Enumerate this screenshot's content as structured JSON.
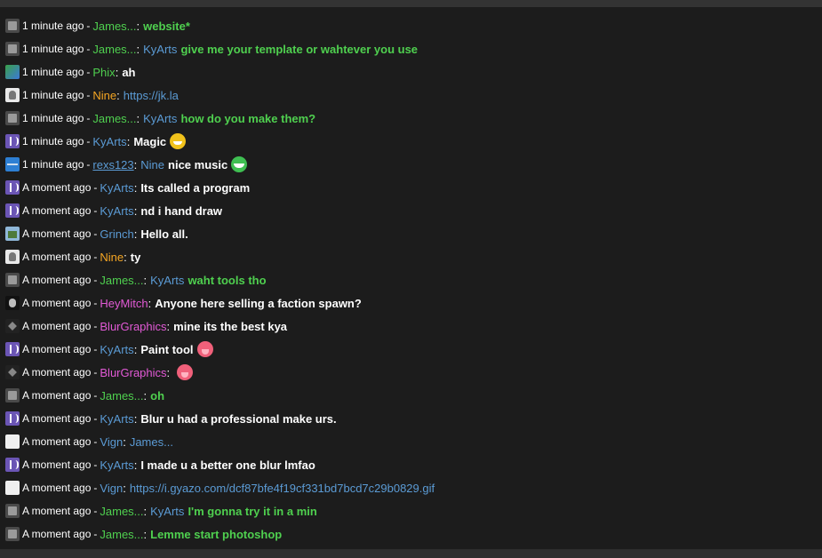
{
  "messages": [
    {
      "avatar": "james",
      "time": "1 minute ago",
      "user": "James...",
      "user_color": "green",
      "mention": "",
      "text": "website*",
      "text_color": "green",
      "link": "",
      "emoji": ""
    },
    {
      "avatar": "james",
      "time": "1 minute ago",
      "user": "James...",
      "user_color": "green",
      "mention": "KyArts",
      "text": "give me your template or wahtever you use",
      "text_color": "green",
      "link": "",
      "emoji": ""
    },
    {
      "avatar": "phix",
      "time": "1 minute ago",
      "user": "Phix",
      "user_color": "green",
      "mention": "",
      "text": "ah",
      "text_color": "white",
      "link": "",
      "emoji": ""
    },
    {
      "avatar": "nine",
      "time": "1 minute ago",
      "user": "Nine",
      "user_color": "orange",
      "mention": "",
      "text": "",
      "text_color": "white",
      "link": "https://jk.la",
      "emoji": ""
    },
    {
      "avatar": "james",
      "time": "1 minute ago",
      "user": "James...",
      "user_color": "green",
      "mention": "KyArts",
      "text": "how do you make them?",
      "text_color": "green",
      "link": "",
      "emoji": ""
    },
    {
      "avatar": "kyarts",
      "time": "1 minute ago",
      "user": "KyArts",
      "user_color": "blue",
      "mention": "",
      "text": "Magic",
      "text_color": "white",
      "link": "",
      "emoji": "grin"
    },
    {
      "avatar": "rexs",
      "time": "1 minute ago",
      "user": "rexs123",
      "user_color": "blue",
      "mention": "Nine",
      "text": "nice music",
      "text_color": "white",
      "link": "",
      "emoji": "green"
    },
    {
      "avatar": "kyarts",
      "time": "A moment ago",
      "user": "KyArts",
      "user_color": "blue",
      "mention": "",
      "text": "Its called a program",
      "text_color": "white",
      "link": "",
      "emoji": ""
    },
    {
      "avatar": "kyarts",
      "time": "A moment ago",
      "user": "KyArts",
      "user_color": "blue",
      "mention": "",
      "text": "nd i hand draw",
      "text_color": "white",
      "link": "",
      "emoji": ""
    },
    {
      "avatar": "grinch",
      "time": "A moment ago",
      "user": "Grinch",
      "user_color": "blue",
      "mention": "",
      "text": "Hello all.",
      "text_color": "white",
      "link": "",
      "emoji": ""
    },
    {
      "avatar": "nine",
      "time": "A moment ago",
      "user": "Nine",
      "user_color": "orange",
      "mention": "",
      "text": "ty",
      "text_color": "white",
      "link": "",
      "emoji": ""
    },
    {
      "avatar": "james",
      "time": "A moment ago",
      "user": "James...",
      "user_color": "green",
      "mention": "KyArts",
      "text": "waht tools tho",
      "text_color": "green",
      "link": "",
      "emoji": ""
    },
    {
      "avatar": "heymitch",
      "time": "A moment ago",
      "user": "HeyMitch",
      "user_color": "pink",
      "mention": "",
      "text": "Anyone here selling a faction spawn?",
      "text_color": "white",
      "link": "",
      "emoji": ""
    },
    {
      "avatar": "blur",
      "time": "A moment ago",
      "user": "BlurGraphics",
      "user_color": "pink",
      "mention": "",
      "text": "mine its the best kya",
      "text_color": "white",
      "link": "",
      "emoji": ""
    },
    {
      "avatar": "kyarts",
      "time": "A moment ago",
      "user": "KyArts",
      "user_color": "blue",
      "mention": "",
      "text": "Paint tool",
      "text_color": "white",
      "link": "",
      "emoji": "tongue"
    },
    {
      "avatar": "blur",
      "time": "A moment ago",
      "user": "BlurGraphics",
      "user_color": "pink",
      "mention": "",
      "text": "",
      "text_color": "white",
      "link": "",
      "emoji": "tongue"
    },
    {
      "avatar": "james",
      "time": "A moment ago",
      "user": "James...",
      "user_color": "green",
      "mention": "",
      "text": "oh",
      "text_color": "green",
      "link": "",
      "emoji": ""
    },
    {
      "avatar": "kyarts",
      "time": "A moment ago",
      "user": "KyArts",
      "user_color": "blue",
      "mention": "",
      "text": "Blur u had a professional make urs.",
      "text_color": "white",
      "link": "",
      "emoji": ""
    },
    {
      "avatar": "vign",
      "time": "A moment ago",
      "user": "Vign",
      "user_color": "blue",
      "mention": "James...",
      "text": "",
      "text_color": "white",
      "link": "",
      "emoji": ""
    },
    {
      "avatar": "kyarts",
      "time": "A moment ago",
      "user": "KyArts",
      "user_color": "blue",
      "mention": "",
      "text": "I made u a better one blur lmfao",
      "text_color": "white",
      "link": "",
      "emoji": ""
    },
    {
      "avatar": "vign",
      "time": "A moment ago",
      "user": "Vign",
      "user_color": "blue",
      "mention": "",
      "text": "",
      "text_color": "white",
      "link": "https://i.gyazo.com/dcf87bfe4f19cf331bd7bcd7c29b0829.gif",
      "emoji": ""
    },
    {
      "avatar": "james",
      "time": "A moment ago",
      "user": "James...",
      "user_color": "green",
      "mention": "KyArts",
      "text": "I'm gonna try it in a min",
      "text_color": "green",
      "link": "",
      "emoji": ""
    },
    {
      "avatar": "james",
      "time": "A moment ago",
      "user": "James...",
      "user_color": "green",
      "mention": "",
      "text": "Lemme start photoshop",
      "text_color": "green",
      "link": "",
      "emoji": ""
    }
  ],
  "separator": "-",
  "colon": ":",
  "underlined_users": [
    "rexs123"
  ]
}
